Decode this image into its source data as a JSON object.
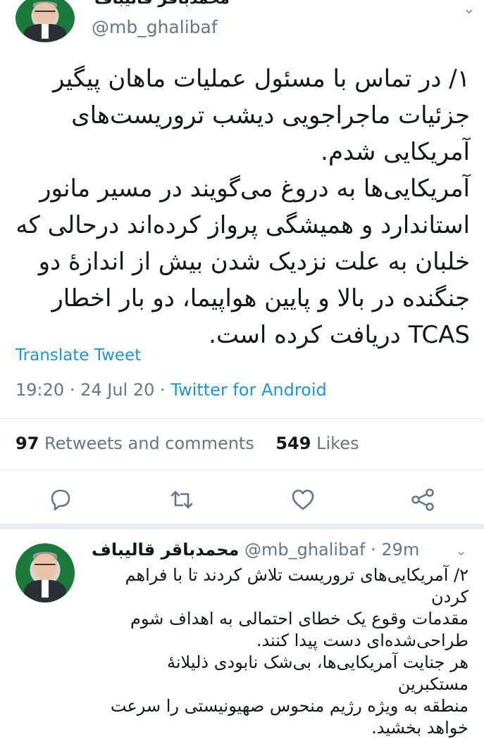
{
  "main_tweet": {
    "display_name": "محمدباقر قالیباف",
    "handle": "@mb_ghalibaf",
    "text": "۱/ در تماس با مسئول عملیات ماهان پیگیر\nجزئیات ماجراجویی دیشب تروریست‌های\nآمریکایی شدم.\nآمریکایی‌ها به دروغ می‌گویند در مسیر مانور\nاستاندارد و همیشگی پرواز کرده‌اند درحالی که\nخلبان به علت نزدیک شدن بیش از اندازهٔ دو\nجنگنده در بالا و پایین هواپیما، دو بار اخطار\nTCAS دریافت کرده است.",
    "translate_label": "Translate Tweet",
    "time": "19:20",
    "date": "24 Jul 20",
    "source": "Twitter for Android",
    "retweets_count": "97",
    "retweets_label": "Retweets and comments",
    "likes_count": "549",
    "likes_label": "Likes"
  },
  "actions": [
    {
      "icon": "reply-icon"
    },
    {
      "icon": "retweet-icon"
    },
    {
      "icon": "like-icon"
    },
    {
      "icon": "share-icon"
    }
  ],
  "reply_tweet": {
    "display_name": "محمدباقر قالیباف",
    "handle": "@mb_ghalibaf",
    "age": "29m",
    "text": "۲/ آمریکایی‌های تروریست تلاش کردند تا با فراهم کردن\nمقدمات وقوع یک خطای احتمالی به اهداف شوم\nطراحی‌شده‌ای دست پیدا کنند.\nهر جنایت آمریکایی‌ها، بی‌شک نابودی ذلیلانهٔ مستکبرین\nمنطقه به ویژه رژیم منحوس صهیونیستی را سرعت\nخواهد بخشید."
  },
  "colors": {
    "link_blue": "#1b95e0",
    "muted_gray": "#657786",
    "text_dark": "#14171a",
    "divider": "#e6ecf0"
  }
}
